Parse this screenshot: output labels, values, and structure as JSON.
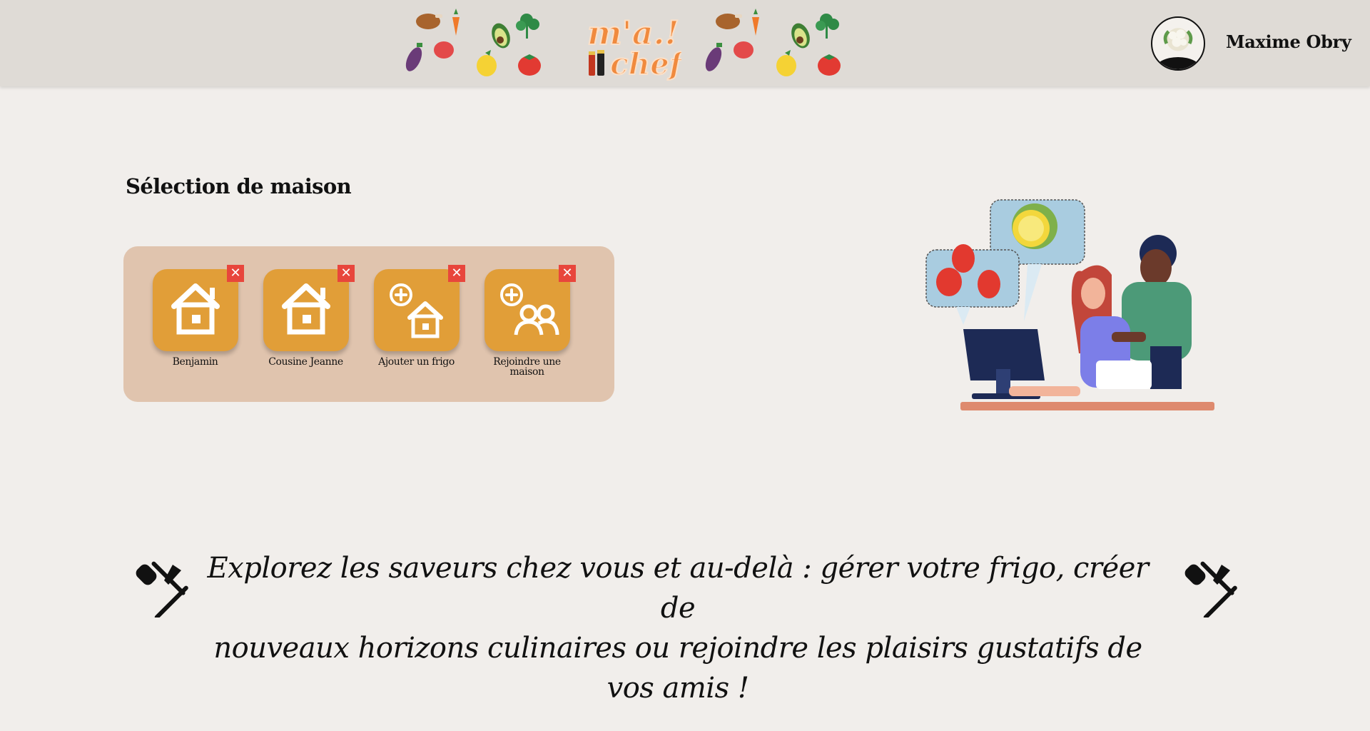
{
  "header": {
    "logo_line1": "m'a.!",
    "logo_line2": "chef",
    "user_name": "Maxime Obry",
    "avatar_icon": "cauliflower-avatar-icon"
  },
  "main": {
    "section_title": "Sélection de maison",
    "houses": [
      {
        "label": "Benjamin",
        "icon": "house-icon"
      },
      {
        "label": "Cousine Jeanne",
        "icon": "house-icon"
      },
      {
        "label": "Ajouter un frigo",
        "icon": "add-house-icon"
      },
      {
        "label": "Rejoindre une maison",
        "icon": "join-house-icon"
      }
    ],
    "close_symbol": "✕"
  },
  "tagline": {
    "line1": "Explorez les saveurs chez vous et au-delà : gérer votre frigo, créer de",
    "line2": "nouveaux horizons culinaires ou rejoindre les plaisirs gustatifs de vos amis !"
  },
  "colors": {
    "header_bg": "#dfdbd6",
    "page_bg": "#f1eeeb",
    "panel_bg": "#e0c4ae",
    "tile_bg": "#e19e38",
    "close_bg": "#e8463c",
    "logo_orange": "#f08a3e"
  }
}
